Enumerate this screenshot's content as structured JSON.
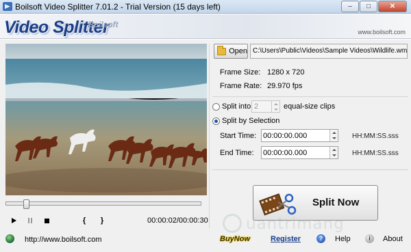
{
  "window": {
    "title": "Boilsoft Video Splitter 7.01.2 - Trial Version (15 days left)",
    "minimize": "–",
    "maximize": "□",
    "close": "✕"
  },
  "banner": {
    "product": "Video Splitter",
    "brand": "Boilsoft",
    "url": "www.boilsoft.com"
  },
  "player": {
    "time": "00:00:02/00:00:30",
    "seek_fraction": 0.09
  },
  "file": {
    "open_label": "Open",
    "path": "C:\\Users\\Public\\Videos\\Sample Videos\\Wildlife.wmv"
  },
  "info": {
    "frame_size_label": "Frame Size:",
    "frame_size_value": "1280 x 720",
    "frame_rate_label": "Frame Rate:",
    "frame_rate_value": "29.970 fps"
  },
  "split_options": {
    "split_into_label": "Split into",
    "split_into_value": "2",
    "split_into_suffix": "equal-size clips",
    "by_selection_label": "Split by Selection",
    "selected": "by_selection"
  },
  "selection": {
    "start_label": "Start Time:",
    "start_value": "00:00:00.000",
    "end_label": "End Time:",
    "end_value": "00:00:00.000",
    "format_hint": "HH:MM:SS.sss"
  },
  "split_button": "Split Now",
  "status": {
    "url": "http://www.boilsoft.com"
  },
  "links": {
    "buy": "BuyNow",
    "register": "Register",
    "help": "Help",
    "about": "About"
  },
  "watermark": "uantrimang",
  "colors": {
    "product_logo": "#1c3e86",
    "buy_glow": "#f3d41a",
    "register": "#1a3c8a"
  }
}
